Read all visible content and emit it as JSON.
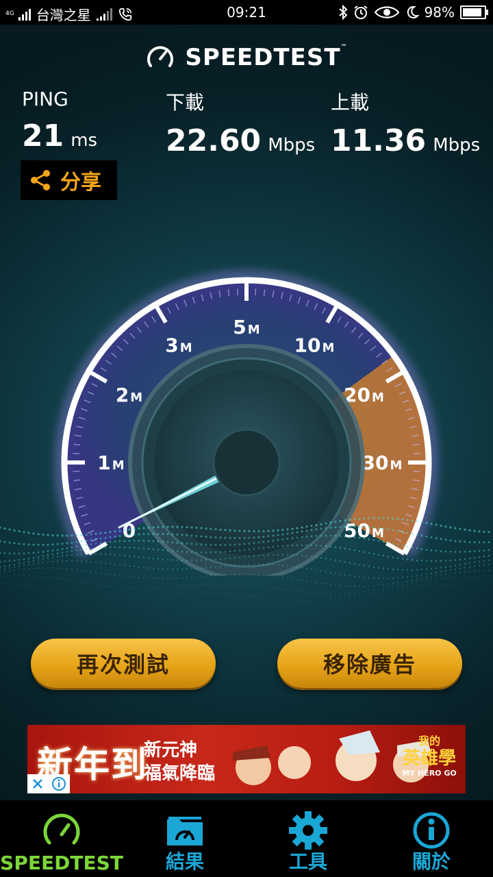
{
  "status_bar": {
    "network_small": "4G",
    "carrier": "台灣之星",
    "time": "09:21",
    "battery": "98%"
  },
  "app": {
    "brand": "SPEEDTEST",
    "tm": "™"
  },
  "results": {
    "ping": {
      "label": "PING",
      "value": "21",
      "unit": "ms"
    },
    "download": {
      "label": "下載",
      "value": "22.60",
      "unit": "Mbps"
    },
    "upload": {
      "label": "上載",
      "value": "11.36",
      "unit": "Mbps"
    }
  },
  "share_label": "分享",
  "gauge": {
    "ticks": [
      {
        "num": "0",
        "unit": ""
      },
      {
        "num": "1",
        "unit": "M"
      },
      {
        "num": "2",
        "unit": "M"
      },
      {
        "num": "3",
        "unit": "M"
      },
      {
        "num": "5",
        "unit": "M"
      },
      {
        "num": "10",
        "unit": "M"
      },
      {
        "num": "20",
        "unit": "M"
      },
      {
        "num": "30",
        "unit": "M"
      },
      {
        "num": "50",
        "unit": "M"
      }
    ]
  },
  "buttons": {
    "retest": "再次測試",
    "remove_ads": "移除廣告"
  },
  "ad": {
    "headline": "新年到",
    "line1": "新元神",
    "line2": "福氣降臨",
    "logo_top": "我的",
    "logo_main": "英雄學",
    "logo_bottom": "MY HERO GO"
  },
  "nav": [
    {
      "label": "SPEEDTEST",
      "icon": "speedometer-icon",
      "active": true
    },
    {
      "label": "結果",
      "icon": "results-folder-icon",
      "active": false
    },
    {
      "label": "工具",
      "icon": "gear-icon",
      "active": false
    },
    {
      "label": "關於",
      "icon": "info-icon",
      "active": false
    }
  ],
  "colors": {
    "active_nav": "#7cd63a",
    "nav_icon": "#1ba7d6",
    "share_text": "#f3a51a",
    "button_gold": "#e6a419",
    "gauge_rim": "#ffffff",
    "gauge_arc": "#7a5bc9",
    "gauge_high_zone": "#d2802c"
  }
}
